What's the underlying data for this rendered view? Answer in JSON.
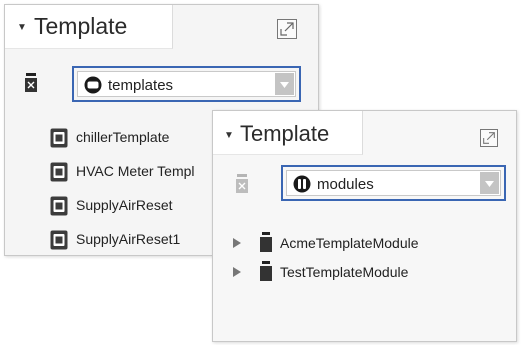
{
  "back_panel": {
    "title": "Template",
    "select_value": "templates",
    "items": [
      {
        "label": "chillerTemplate"
      },
      {
        "label": "HVAC Meter Templ"
      },
      {
        "label": "SupplyAirReset"
      },
      {
        "label": "SupplyAirReset1"
      }
    ]
  },
  "front_panel": {
    "title": "Template",
    "select_value": "modules",
    "items": [
      {
        "label": "AcmeTemplateModule"
      },
      {
        "label": "TestTemplateModule"
      }
    ]
  },
  "colors": {
    "select_border": "#3a66b3",
    "panel_bg": "#f5f5f5"
  },
  "icons": {
    "library": "jar-icon",
    "template": "template-file-icon",
    "module": "jar-icon",
    "expand": "expand-icon"
  }
}
